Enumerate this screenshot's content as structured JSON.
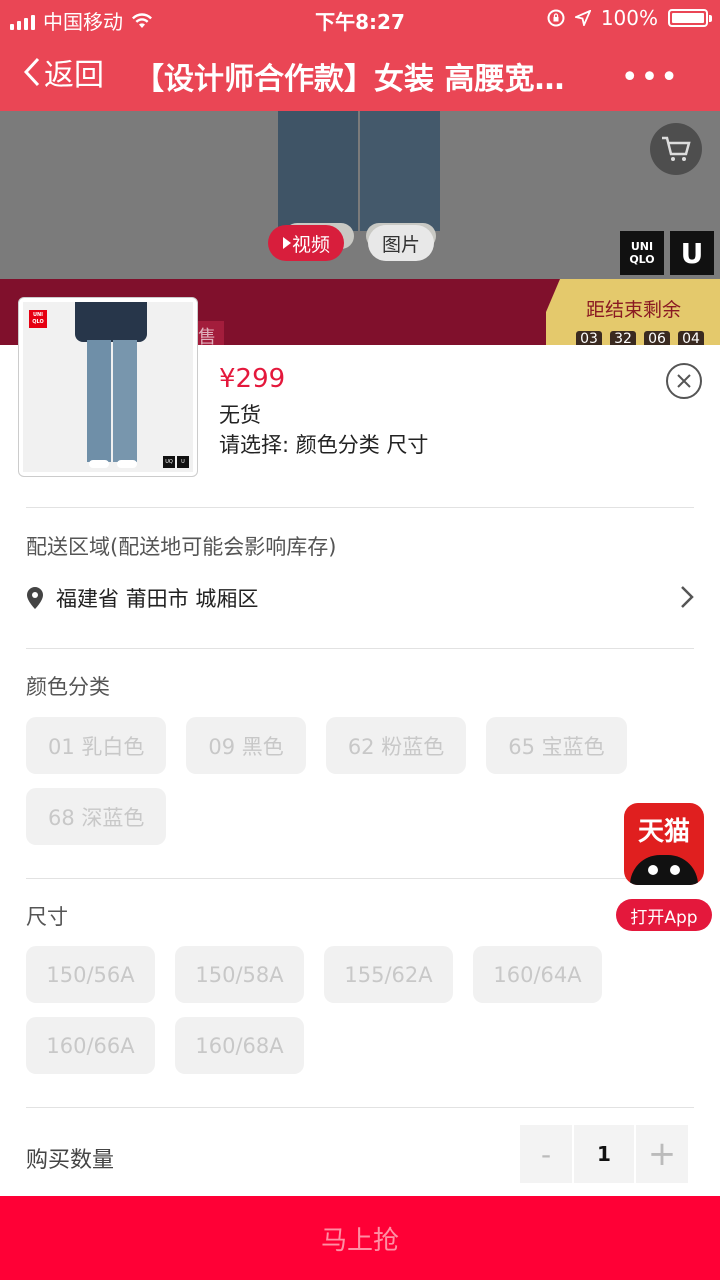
{
  "status": {
    "carrier": "中国移动",
    "time": "下午8:27",
    "battery": "100%",
    "battery_level": 1.0
  },
  "nav": {
    "back_label": "返回",
    "title": "【设计师合作款】女装 高腰宽腿牛仔裤",
    "more_label": "•••"
  },
  "media": {
    "video_label": "视频",
    "photo_label": "图片",
    "logo_text": "UNIQLO",
    "logo_u": "U"
  },
  "promo": {
    "presale_text": "售",
    "countdown_label": "距结束剩余",
    "countdown_digits": [
      "03",
      "32",
      "06",
      "04"
    ]
  },
  "product": {
    "price": "¥299",
    "stock": "无货",
    "prompt": "请选择: 颜色分类   尺寸",
    "thumb_brand": "UNIQLO",
    "thumb_brand_u": "U"
  },
  "delivery": {
    "label": "配送区域(配送地可能会影响库存)",
    "address": "福建省 莆田市 城厢区"
  },
  "color": {
    "label": "颜色分类",
    "options": [
      "01 乳白色",
      "09 黑色",
      "62 粉蓝色",
      "65 宝蓝色",
      "68 深蓝色"
    ]
  },
  "size": {
    "label": "尺寸",
    "options": [
      "150/56A",
      "150/58A",
      "155/62A",
      "160/64A",
      "160/66A",
      "160/68A"
    ]
  },
  "quantity": {
    "label": "购买数量",
    "minus": "-",
    "value": "1",
    "plus": "+"
  },
  "tmall": {
    "app_name": "天猫",
    "open_label": "打开App"
  },
  "buy": {
    "label": "马上抢"
  },
  "colors": {
    "nav_red": "#ea4655",
    "price_red": "#e4183c",
    "buy_red": "#ff0036"
  }
}
